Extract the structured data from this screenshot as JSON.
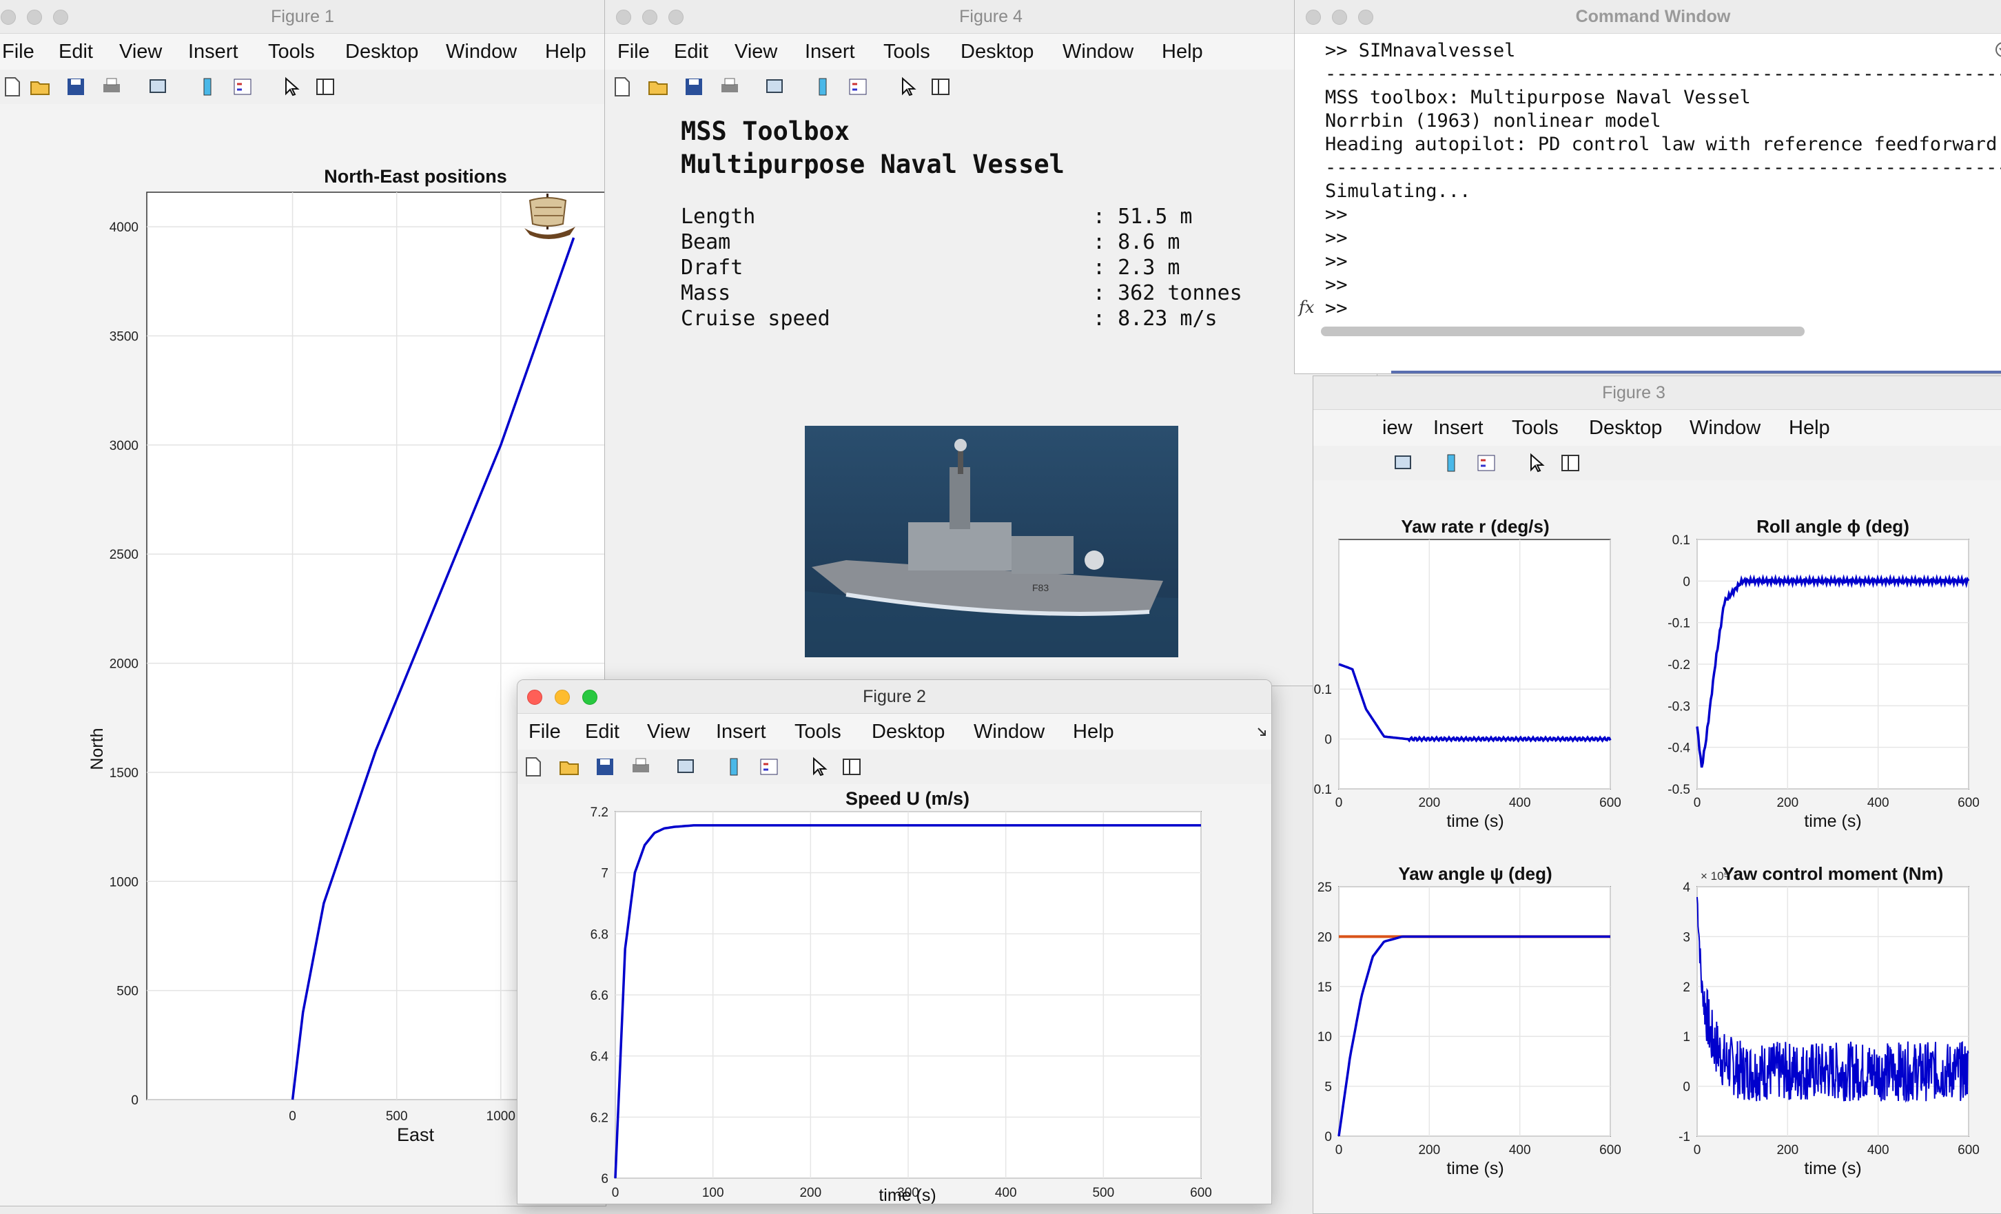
{
  "menu": [
    "File",
    "Edit",
    "View",
    "Insert",
    "Tools",
    "Desktop",
    "Window",
    "Help"
  ],
  "menu_fig3": [
    "iew",
    "Insert",
    "Tools",
    "Desktop",
    "Window",
    "Help"
  ],
  "fig1": {
    "title": "Figure 1",
    "plot_title": "North-East positions",
    "xlabel": "East",
    "ylabel": "North",
    "yticks": [
      "0",
      "500",
      "1000",
      "1500",
      "2000",
      "2500",
      "3000",
      "3500",
      "4000"
    ],
    "xticks": [
      "0",
      "500",
      "1000"
    ]
  },
  "fig4": {
    "title": "Figure 4",
    "heading1": "MSS Toolbox",
    "heading2": "Multipurpose Naval Vessel",
    "specs": [
      {
        "label": "Length",
        "value": ": 51.5 m"
      },
      {
        "label": "Beam",
        "value": ": 8.6 m"
      },
      {
        "label": "Draft",
        "value": ": 2.3 m"
      },
      {
        "label": "Mass",
        "value": ": 362 tonnes"
      },
      {
        "label": "Cruise speed",
        "value": ": 8.23 m/s"
      }
    ]
  },
  "cmd": {
    "title": "Command Window",
    "fx": "fx",
    "lines": [
      ">> SIMnavalvessel",
      "",
      "MSS toolbox: Multipurpose Naval Vessel",
      "Norrbin (1963) nonlinear model",
      "Heading autopilot: PD control law with reference feedforward",
      "",
      "Simulating...",
      ">>",
      ">>",
      ">>",
      ">>",
      ">>"
    ],
    "divider": "---------------------------------------------------------------------------"
  },
  "fig3": {
    "title": "Figure 3",
    "yaw_rate": {
      "title": "Yaw rate r (deg/s)",
      "xlabel": "time (s)",
      "yticks": [
        "0.1",
        "0",
        "-0.1"
      ],
      "xticks": [
        "0",
        "200",
        "400",
        "600"
      ]
    },
    "roll": {
      "title": "Roll angle ϕ (deg)",
      "xlabel": "time (s)",
      "yticks": [
        "0.1",
        "0",
        "-0.1",
        "-0.2",
        "-0.3",
        "-0.4",
        "-0.5"
      ],
      "xticks": [
        "0",
        "200",
        "400",
        "600"
      ]
    },
    "yaw": {
      "title": "Yaw angle ψ (deg)",
      "xlabel": "time (s)",
      "yticks": [
        "25",
        "20",
        "15",
        "10",
        "5",
        "0"
      ],
      "xticks": [
        "0",
        "200",
        "400",
        "600"
      ]
    },
    "moment": {
      "title": "Yaw control moment (Nm)",
      "xlabel": "time (s)",
      "exponent": "× 10⁵",
      "yticks": [
        "4",
        "3",
        "2",
        "1",
        "0",
        "-1"
      ],
      "xticks": [
        "0",
        "200",
        "400",
        "600"
      ]
    }
  },
  "fig2": {
    "title": "Figure 2",
    "plot_title": "Speed U (m/s)",
    "xlabel": "time (s)",
    "yticks": [
      "7.2",
      "7",
      "6.8",
      "6.6",
      "6.4",
      "6.2",
      "6"
    ],
    "xticks": [
      "0",
      "100",
      "200",
      "300",
      "400",
      "500",
      "600"
    ]
  },
  "colors": {
    "line": "#0000cc",
    "ref": "#d95319"
  },
  "chart_data": [
    {
      "type": "line",
      "title": "North-East positions",
      "xlabel": "East",
      "ylabel": "North",
      "ylim": [
        0,
        4200
      ],
      "series": [
        {
          "x": [
            0,
            50,
            150,
            400,
            700,
            1000,
            1350
          ],
          "y": [
            0,
            400,
            900,
            1600,
            2300,
            3000,
            3950
          ]
        }
      ]
    },
    {
      "type": "line",
      "title": "Speed U (m/s)",
      "xlabel": "time (s)",
      "xlim": [
        0,
        600
      ],
      "ylim": [
        6,
        7.2
      ],
      "series": [
        {
          "x": [
            0,
            10,
            20,
            30,
            40,
            50,
            60,
            80,
            100,
            600
          ],
          "y": [
            6,
            6.75,
            7.0,
            7.09,
            7.13,
            7.145,
            7.15,
            7.155,
            7.155,
            7.155
          ]
        }
      ]
    },
    {
      "type": "line",
      "title": "Yaw rate r (deg/s)",
      "xlabel": "time (s)",
      "xlim": [
        0,
        600
      ],
      "series": [
        {
          "x": [
            0,
            30,
            60,
            100,
            150,
            600
          ],
          "y": [
            0.15,
            0.14,
            0.06,
            0.005,
            0,
            0
          ]
        }
      ]
    },
    {
      "type": "line",
      "title": "Roll angle ϕ (deg)",
      "xlabel": "time (s)",
      "xlim": [
        0,
        600
      ],
      "ylim": [
        -0.5,
        0.1
      ],
      "series": [
        {
          "x": [
            0,
            10,
            20,
            40,
            60,
            100,
            600
          ],
          "y": [
            -0.35,
            -0.45,
            -0.38,
            -0.2,
            -0.05,
            0,
            0
          ]
        }
      ]
    },
    {
      "type": "line",
      "title": "Yaw angle ψ (deg)",
      "xlabel": "time (s)",
      "xlim": [
        0,
        600
      ],
      "ylim": [
        0,
        25
      ],
      "series": [
        {
          "name": "yaw",
          "x": [
            0,
            25,
            50,
            75,
            100,
            140,
            600
          ],
          "y": [
            0,
            8,
            14,
            18,
            19.5,
            20,
            20
          ]
        },
        {
          "name": "ref",
          "x": [
            0,
            600
          ],
          "y": [
            20,
            20
          ]
        }
      ]
    },
    {
      "type": "line",
      "title": "Yaw control moment (Nm)",
      "xlabel": "time (s)",
      "xlim": [
        0,
        600
      ],
      "ylim": [
        -1,
        4
      ],
      "series": [
        {
          "x": [
            0,
            10,
            30,
            60,
            100,
            600
          ],
          "y": [
            3.8,
            2,
            1,
            0.5,
            0.3,
            0.3
          ]
        }
      ]
    }
  ]
}
